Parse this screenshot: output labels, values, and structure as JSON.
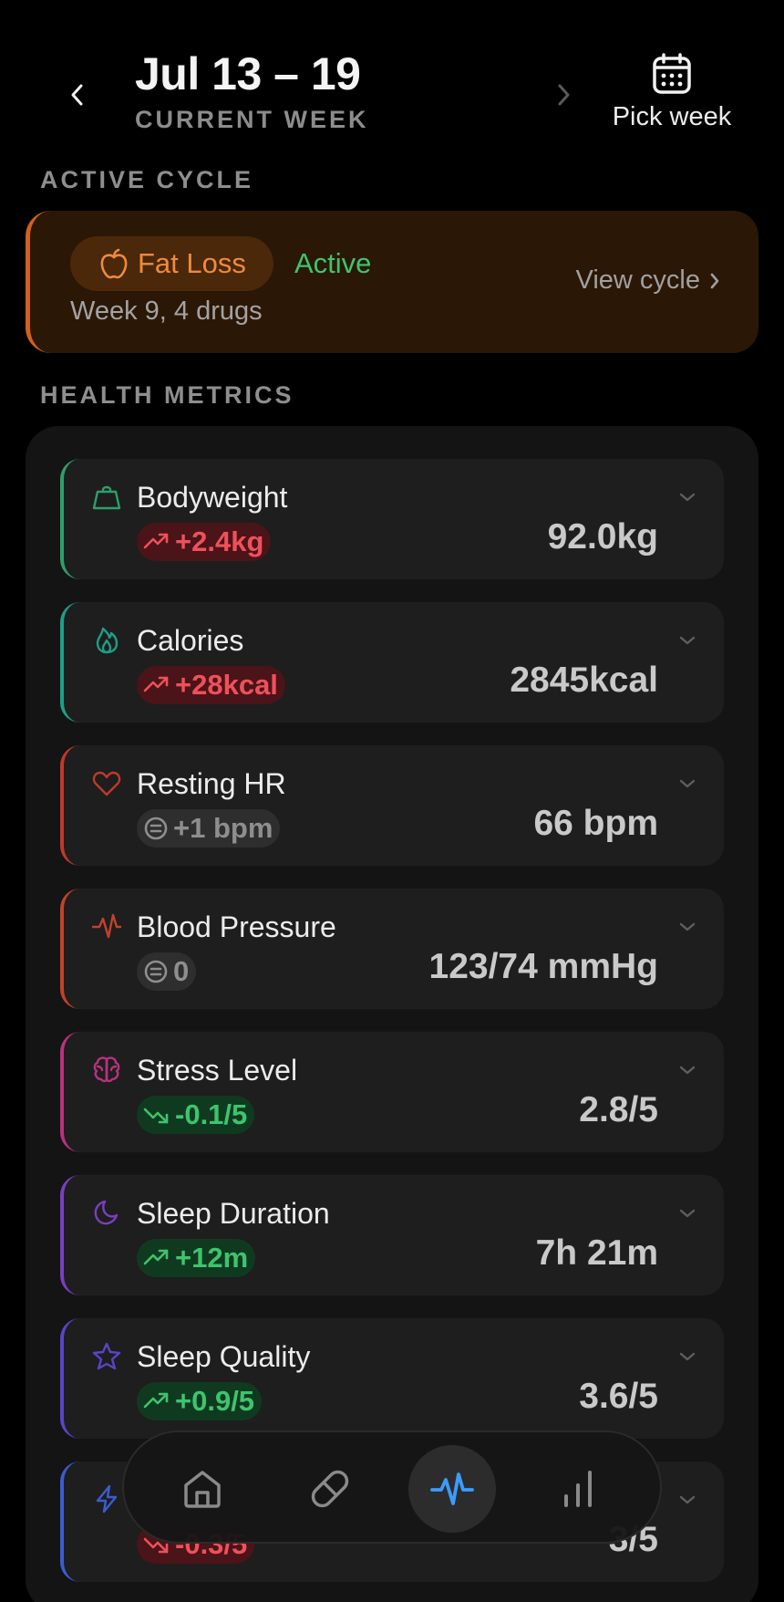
{
  "header": {
    "title": "Jul 13 – 19",
    "subtitle": "CURRENT WEEK",
    "pick_week_label": "Pick week"
  },
  "sections": {
    "active_cycle": "ACTIVE CYCLE",
    "health_metrics": "HEALTH METRICS"
  },
  "cycle": {
    "goal": "Fat Loss",
    "status": "Active",
    "detail": "Week 9, 4 drugs",
    "link_label": "View cycle"
  },
  "metrics": [
    {
      "name": "Bodyweight",
      "change": "+2.4kg",
      "value": "92.0kg",
      "icon": "weight-icon",
      "accent": "#2f9e6b",
      "trend": "up"
    },
    {
      "name": "Calories",
      "change": "+28kcal",
      "value": "2845kcal",
      "icon": "flame-icon",
      "accent": "#1f9e88",
      "trend": "up"
    },
    {
      "name": "Resting HR",
      "change": "+1 bpm",
      "value": "66 bpm",
      "icon": "heart-icon",
      "accent": "#c0392b",
      "trend": "flat"
    },
    {
      "name": "Blood Pressure",
      "change": "0",
      "value": "123/74 mmHg",
      "icon": "pulse-icon",
      "accent": "#c0432b",
      "trend": "flat"
    },
    {
      "name": "Stress Level",
      "change": "-0.1/5",
      "value": "2.8/5",
      "icon": "brain-icon",
      "accent": "#b8327f",
      "trend": "down-good"
    },
    {
      "name": "Sleep Duration",
      "change": "+12m",
      "value": "7h 21m",
      "icon": "moon-icon",
      "accent": "#7a3fc0",
      "trend": "up-good"
    },
    {
      "name": "Sleep Quality",
      "change": "+0.9/5",
      "value": "3.6/5",
      "icon": "star-icon",
      "accent": "#5a44c8",
      "trend": "up-good"
    },
    {
      "name": "",
      "change": "-0.3/5",
      "value": "3/5",
      "icon": "bolt-icon",
      "accent": "#3b5cd0",
      "trend": "down-bad"
    }
  ],
  "tabs": [
    {
      "name": "home",
      "icon": "home-icon",
      "active": false
    },
    {
      "name": "medications",
      "icon": "pill-icon",
      "active": false
    },
    {
      "name": "health",
      "icon": "pulse-icon",
      "active": true
    },
    {
      "name": "stats",
      "icon": "bar-chart-icon",
      "active": false
    }
  ],
  "colors": {
    "accent_orange": "#f08a3c",
    "positive_green": "#3ec46d",
    "negative_red": "#f0505a",
    "active_tab_blue": "#3d9bff"
  }
}
